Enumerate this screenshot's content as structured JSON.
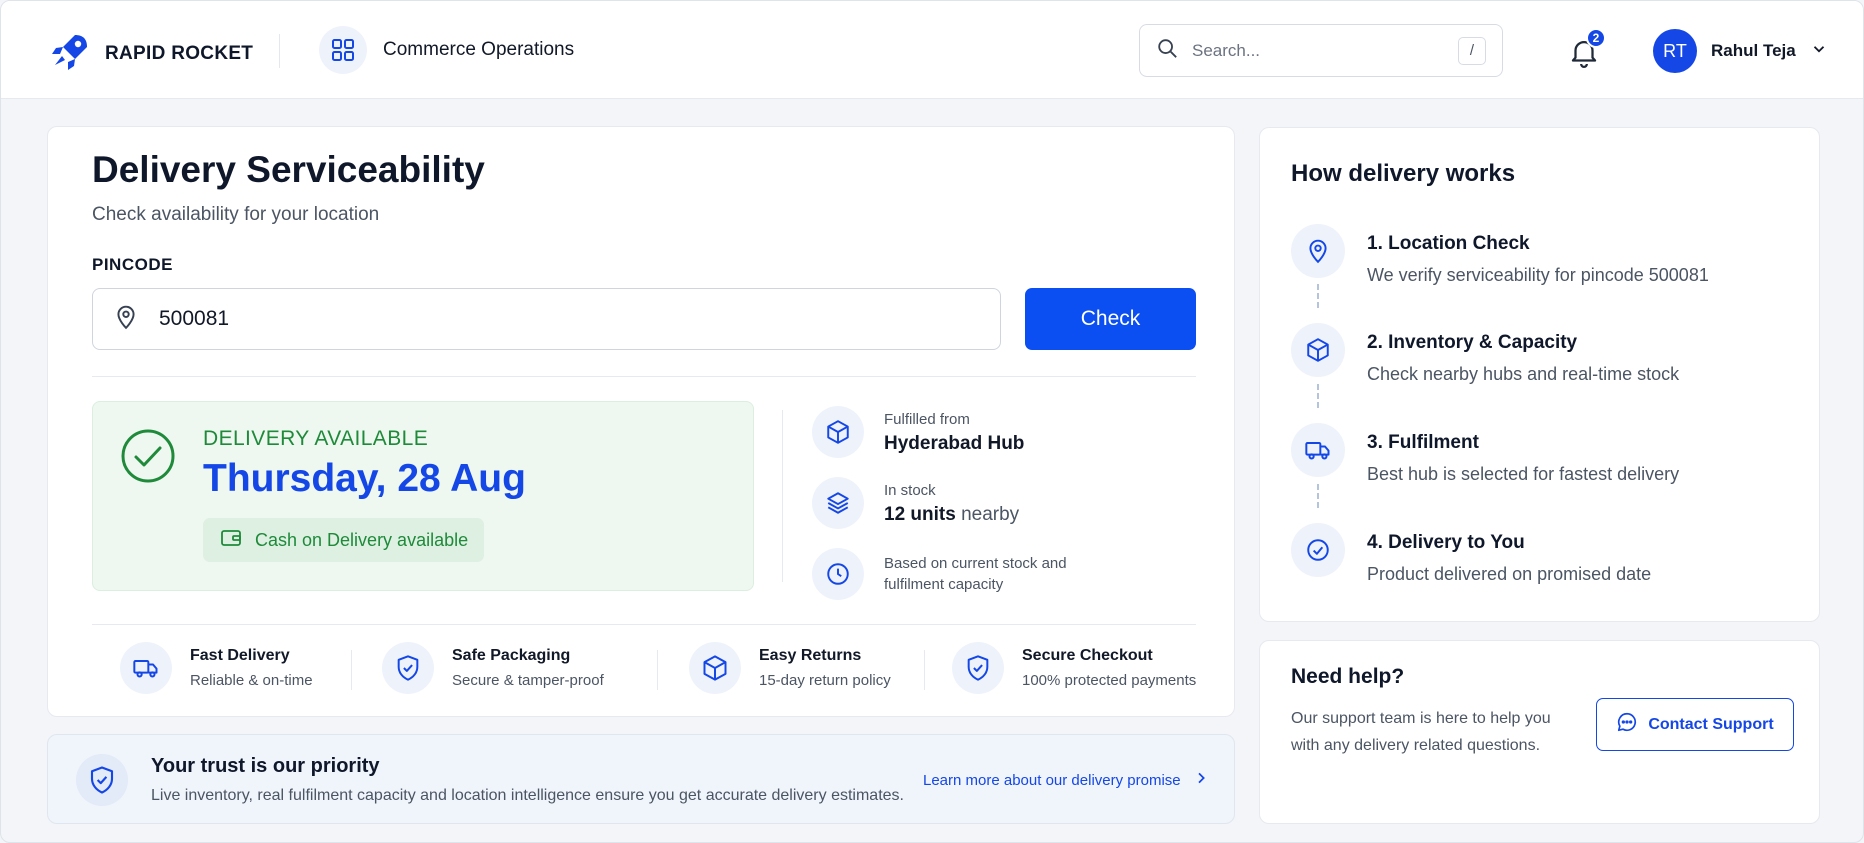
{
  "header": {
    "brand": "RAPID ROCKET",
    "module": "Commerce Operations",
    "search_placeholder": "Search...",
    "search_shortcut": "/",
    "notification_count": "2",
    "user_initials": "RT",
    "user_name": "Rahul Teja"
  },
  "main": {
    "title": "Delivery Serviceability",
    "subtitle": "Check availability for your location",
    "pincode_label": "PINCODE",
    "pincode_value": "500081",
    "check_label": "Check",
    "result": {
      "status": "DELIVERY AVAILABLE",
      "date": "Thursday, 28 Aug",
      "cod": "Cash on Delivery available"
    },
    "info": {
      "fulfilled_label": "Fulfilled from",
      "fulfilled_value": "Hyderabad Hub",
      "stock_label": "In stock",
      "stock_count": "12 units",
      "stock_suffix": " nearby",
      "basis_line1": "Based on current stock and",
      "basis_line2": "fulfilment capacity"
    },
    "features": [
      {
        "title": "Fast Delivery",
        "sub": "Reliable & on-time"
      },
      {
        "title": "Safe Packaging",
        "sub": "Secure & tamper-proof"
      },
      {
        "title": "Easy Returns",
        "sub": "15-day return policy"
      },
      {
        "title": "Secure Checkout",
        "sub": "100% protected payments"
      }
    ]
  },
  "trust": {
    "title": "Your trust is our priority",
    "subtitle": "Live inventory, real fulfilment capacity and location intelligence ensure you get accurate delivery estimates.",
    "link": "Learn more about our delivery promise"
  },
  "how": {
    "title": "How delivery works",
    "steps": [
      {
        "title": "1. Location Check",
        "desc": "We verify serviceability for pincode 500081"
      },
      {
        "title": "2. Inventory & Capacity",
        "desc": "Check nearby hubs and real-time stock"
      },
      {
        "title": "3. Fulfilment",
        "desc": "Best hub is selected for fastest delivery"
      },
      {
        "title": "4. Delivery to You",
        "desc": "Product delivered on promised date"
      }
    ]
  },
  "help": {
    "title": "Need help?",
    "desc": "Our support team is here to help you with any delivery related questions.",
    "button": "Contact Support"
  },
  "colors": {
    "primary": "#1447e6",
    "button": "#0b4ff2",
    "success": "#1e8a3a",
    "success_bg": "#eef7f0"
  }
}
